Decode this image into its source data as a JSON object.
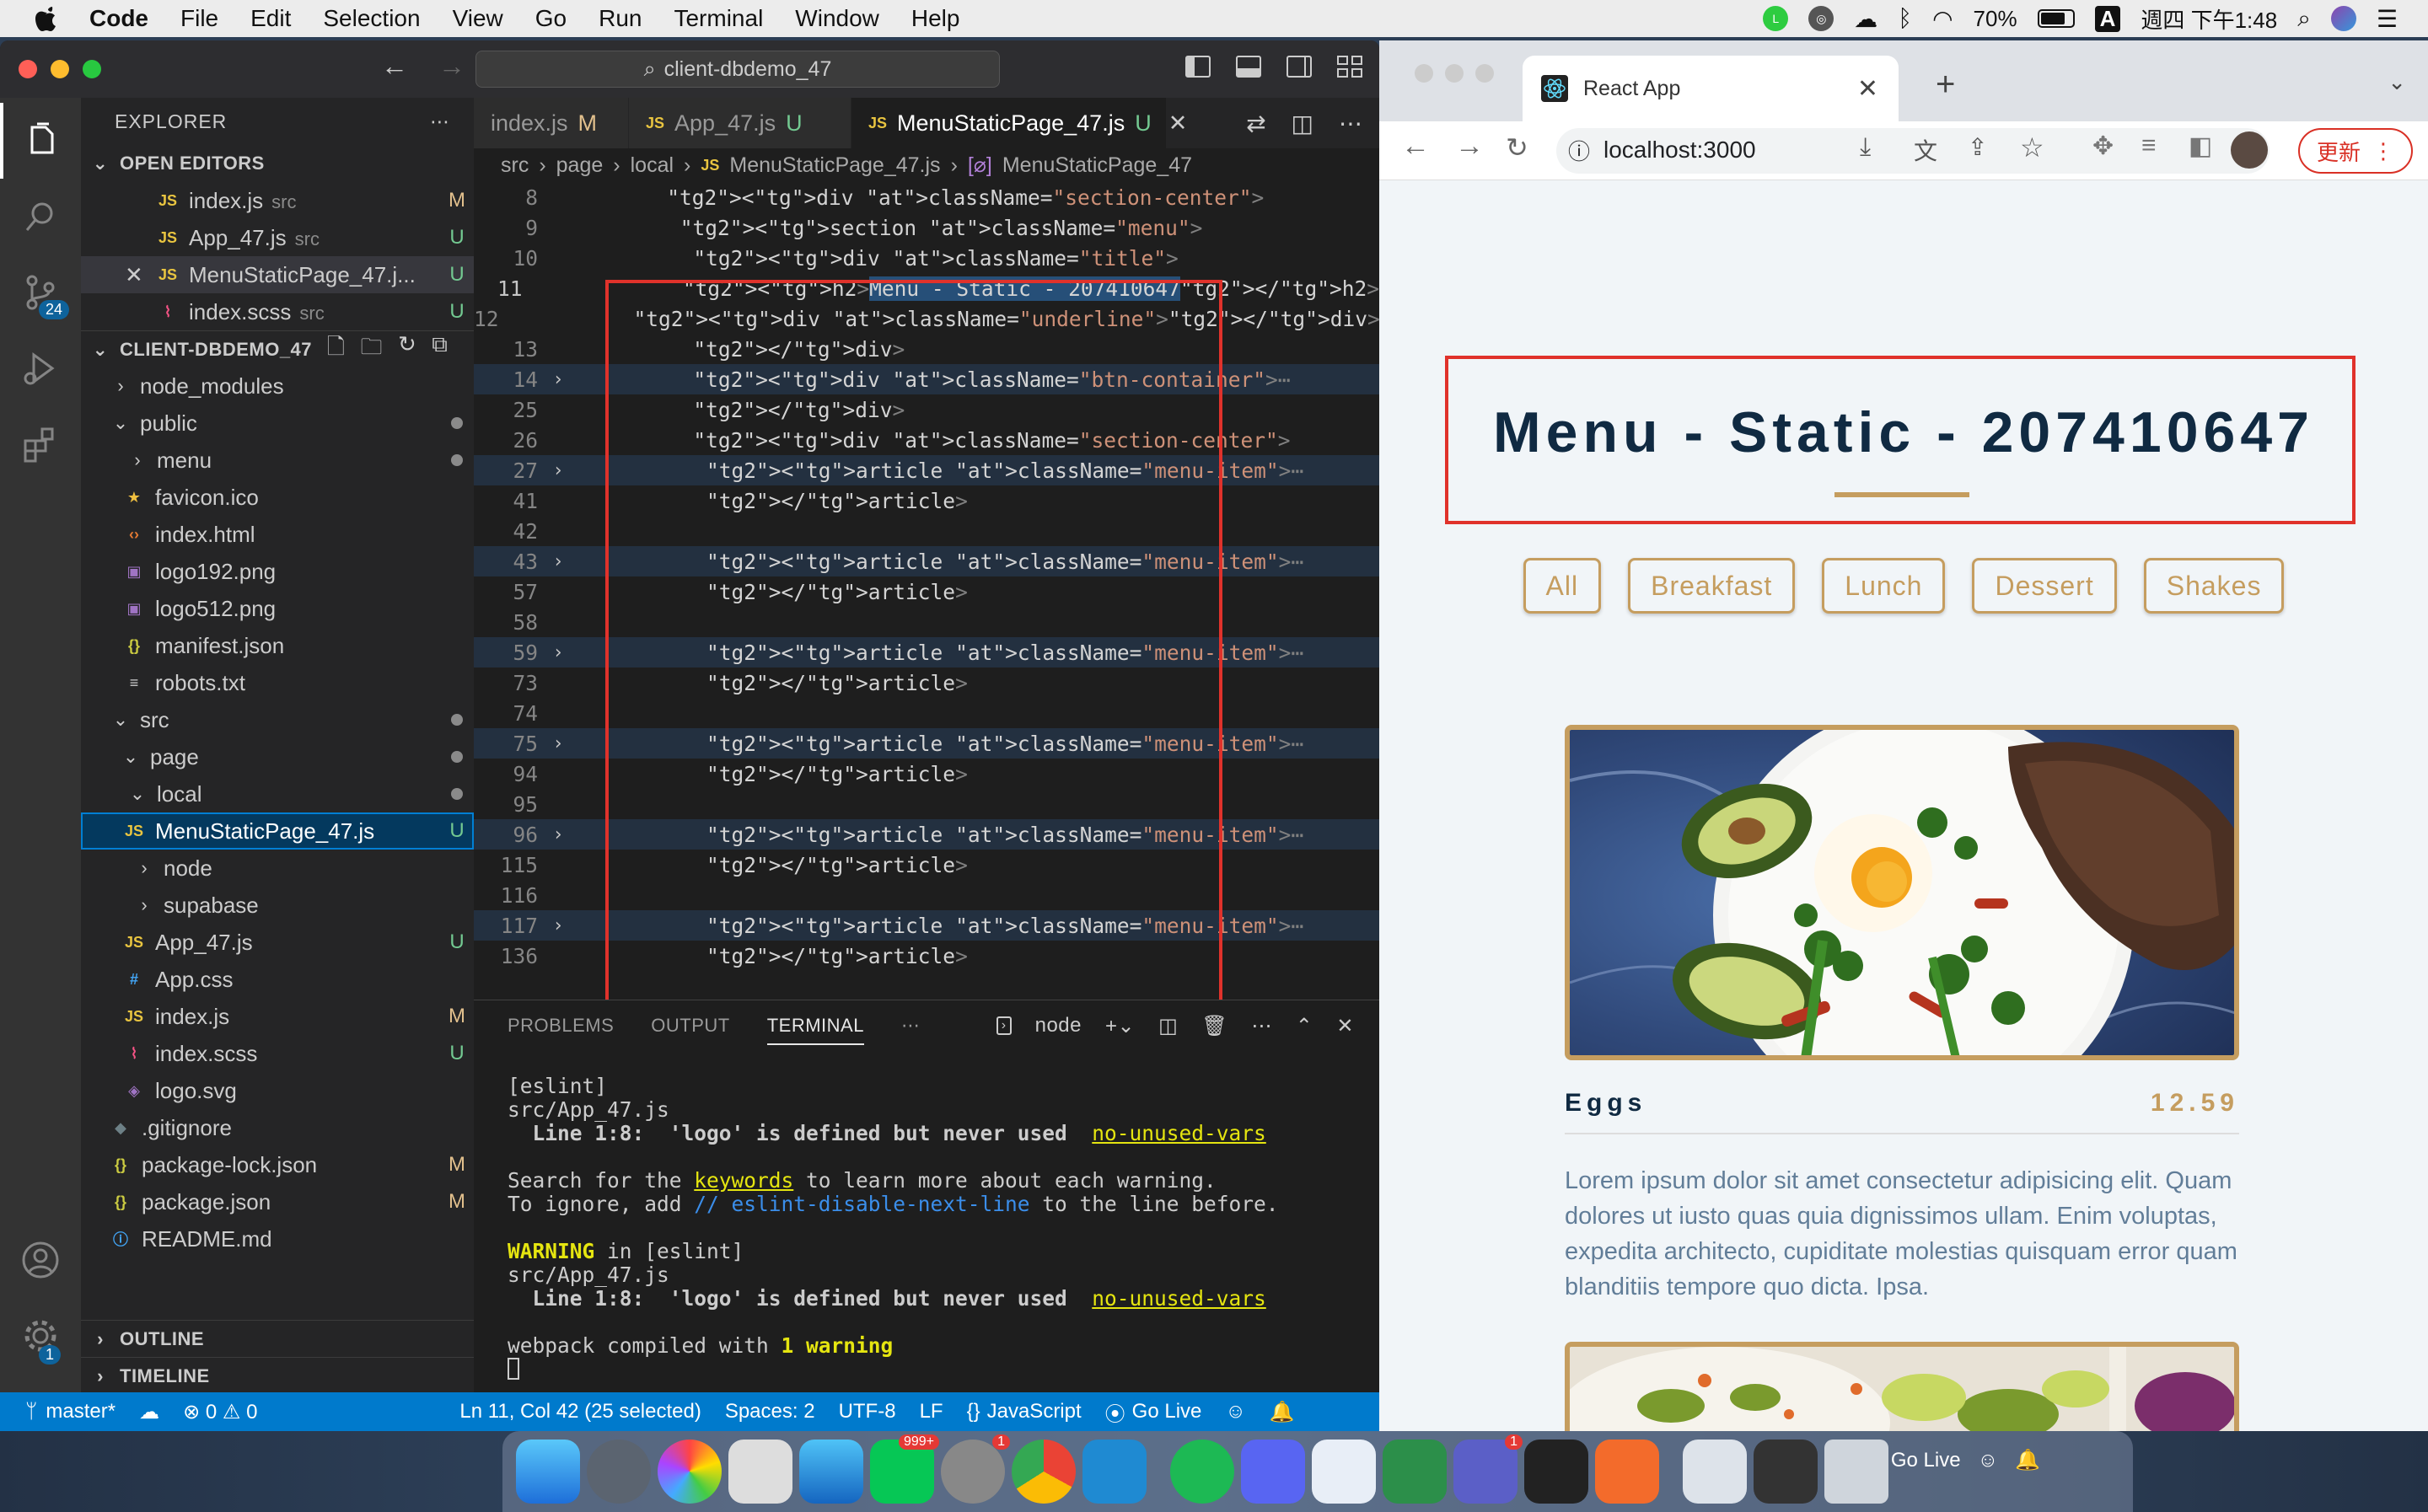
{
  "menubar": {
    "app": "Code",
    "items": [
      "File",
      "Edit",
      "Selection",
      "View",
      "Go",
      "Run",
      "Terminal",
      "Window",
      "Help"
    ],
    "battery": "70%",
    "ime": "A",
    "datetime": "週四 下午1:48"
  },
  "vscode": {
    "search": "client-dbdemo_47",
    "activity_badge": "24",
    "settings_badge": "1",
    "explorer_title": "EXPLORER",
    "open_editors_title": "OPEN EDITORS",
    "open_editors": [
      {
        "name": "index.js",
        "sub": "src",
        "status": "M",
        "icon": "JS"
      },
      {
        "name": "App_47.js",
        "sub": "src",
        "status": "U",
        "icon": "JS"
      },
      {
        "name": "MenuStaticPage_47.j...",
        "sub": "",
        "status": "U",
        "icon": "JS"
      },
      {
        "name": "index.scss",
        "sub": "src",
        "status": "U",
        "icon": "scss"
      }
    ],
    "project_title": "CLIENT-DBDEMO_47",
    "tree": [
      {
        "name": "node_modules",
        "status": ""
      },
      {
        "name": "public",
        "status": "dot"
      },
      {
        "name": "menu",
        "status": "dot"
      },
      {
        "name": "favicon.ico",
        "status": ""
      },
      {
        "name": "index.html",
        "status": ""
      },
      {
        "name": "logo192.png",
        "status": ""
      },
      {
        "name": "logo512.png",
        "status": ""
      },
      {
        "name": "manifest.json",
        "status": ""
      },
      {
        "name": "robots.txt",
        "status": ""
      },
      {
        "name": "src",
        "status": "dot"
      },
      {
        "name": "page",
        "status": "dot"
      },
      {
        "name": "local",
        "status": "dot"
      },
      {
        "name": "MenuStaticPage_47.js",
        "status": "U"
      },
      {
        "name": "node",
        "status": ""
      },
      {
        "name": "supabase",
        "status": ""
      },
      {
        "name": "App_47.js",
        "status": "U"
      },
      {
        "name": "App.css",
        "status": ""
      },
      {
        "name": "index.js",
        "status": "M"
      },
      {
        "name": "index.scss",
        "status": "U"
      },
      {
        "name": "logo.svg",
        "status": ""
      },
      {
        "name": ".gitignore",
        "status": ""
      },
      {
        "name": "package-lock.json",
        "status": "M"
      },
      {
        "name": "package.json",
        "status": "M"
      },
      {
        "name": "README.md",
        "status": ""
      }
    ],
    "outline": "OUTLINE",
    "timeline": "TIMELINE",
    "tabs": [
      {
        "name": "index.js",
        "status": "M"
      },
      {
        "name": "App_47.js",
        "status": "U"
      },
      {
        "name": "MenuStaticPage_47.js",
        "status": "U"
      }
    ],
    "breadcrumb": [
      "src",
      "page",
      "local",
      "MenuStaticPage_47.js",
      "MenuStaticPage_47"
    ],
    "code_lines": [
      {
        "n": "8",
        "code": "<div className=\"section-center\">"
      },
      {
        "n": "9",
        "code": "<section className=\"menu\">"
      },
      {
        "n": "10",
        "code": "<div className=\"title\">"
      },
      {
        "n": "11",
        "code": "<h2>Menu - Static - 207410647</h2>"
      },
      {
        "n": "12",
        "code": "<div className=\"underline\"></div>"
      },
      {
        "n": "13",
        "code": "</div>"
      },
      {
        "n": "14",
        "code": "<div className=\"btn-container\">⋯"
      },
      {
        "n": "25",
        "code": "</div>"
      },
      {
        "n": "26",
        "code": "<div className=\"section-center\">"
      },
      {
        "n": "27",
        "code": "<article className=\"menu-item\">⋯"
      },
      {
        "n": "41",
        "code": "</article>"
      },
      {
        "n": "42",
        "code": ""
      },
      {
        "n": "43",
        "code": "<article className=\"menu-item\">⋯"
      },
      {
        "n": "57",
        "code": "</article>"
      },
      {
        "n": "58",
        "code": ""
      },
      {
        "n": "59",
        "code": "<article className=\"menu-item\">⋯"
      },
      {
        "n": "73",
        "code": "</article>"
      },
      {
        "n": "74",
        "code": ""
      },
      {
        "n": "75",
        "code": "<article className=\"menu-item\">⋯"
      },
      {
        "n": "94",
        "code": "</article>"
      },
      {
        "n": "95",
        "code": ""
      },
      {
        "n": "96",
        "code": "<article className=\"menu-item\">⋯"
      },
      {
        "n": "115",
        "code": "</article>"
      },
      {
        "n": "116",
        "code": ""
      },
      {
        "n": "117",
        "code": "<article className=\"menu-item\">⋯"
      },
      {
        "n": "136",
        "code": "</article>"
      }
    ],
    "panel_tabs": [
      "PROBLEMS",
      "OUTPUT",
      "TERMINAL"
    ],
    "terminal_shell": "node",
    "terminal": {
      "l1": "[eslint]",
      "l2": "src/App_47.js",
      "l3a": "  Line 1:8:  'logo' is defined but never used  ",
      "rule": "no-unused-vars",
      "l5a": "Search for the ",
      "keywords": "keywords",
      "l5b": " to learn more about each warning.",
      "l6a": "To ignore, add ",
      "disable": "// eslint-disable-next-line",
      "l6b": " to the line before.",
      "warning": "WARNING",
      "l8b": " in [eslint]",
      "l11a": "webpack compiled with ",
      "l11b": "1 warning"
    },
    "status": {
      "branch": "master*",
      "problems": "⊗ 0 ⚠ 0",
      "position": "Ln 11, Col 42 (25 selected)",
      "spaces": "Spaces: 2",
      "encoding": "UTF-8",
      "eol": "LF",
      "language": "JavaScript",
      "golive": "Go Live"
    }
  },
  "chrome": {
    "tab_title": "React App",
    "url": "localhost:3000",
    "update": "更新",
    "page": {
      "title": "Menu - Static - 207410647",
      "filters": [
        "All",
        "Breakfast",
        "Lunch",
        "Dessert",
        "Shakes"
      ],
      "item": {
        "name": "Eggs",
        "price": "12.59",
        "desc": "Lorem ipsum dolor sit amet consectetur adipisicing elit. Quam dolores ut iusto quas quia dignissimos ullam. Enim voluptas, expedita architecto, cupiditate molestias quisquam error quam blanditiis tempore quo dicta. Ipsa."
      }
    }
  },
  "dock": {
    "line_badge": "999+",
    "prefs_badge": "1",
    "teams_badge": "1",
    "golive": "Go Live"
  }
}
